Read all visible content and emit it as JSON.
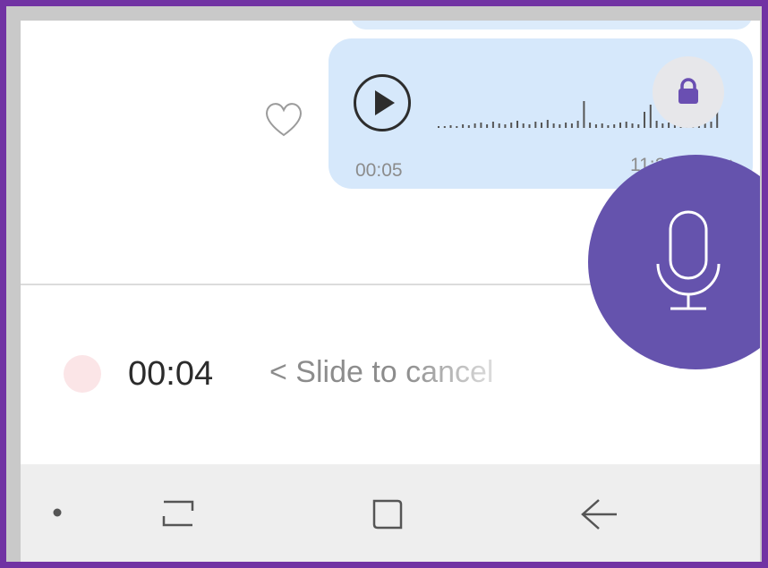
{
  "voice_message": {
    "duration": "00:05",
    "time": "11:28"
  },
  "recording": {
    "timer": "00:04",
    "slide_hint": "< Slide to cancel"
  },
  "icons": {
    "play": "play-icon",
    "lock": "lock-icon",
    "heart": "heart-icon",
    "microphone": "microphone-icon",
    "read_ticks": "double-check-icon",
    "nav_recents": "recent-apps-icon",
    "nav_home": "home-icon",
    "nav_back": "back-arrow-icon"
  },
  "colors": {
    "frame_border": "#7133a3",
    "bubble": "#d6e8fb",
    "mic_button": "#6553ad",
    "lock_accent": "#6a4fb2",
    "record_dot": "#fbe5e7",
    "navbar": "#eeeeee"
  }
}
